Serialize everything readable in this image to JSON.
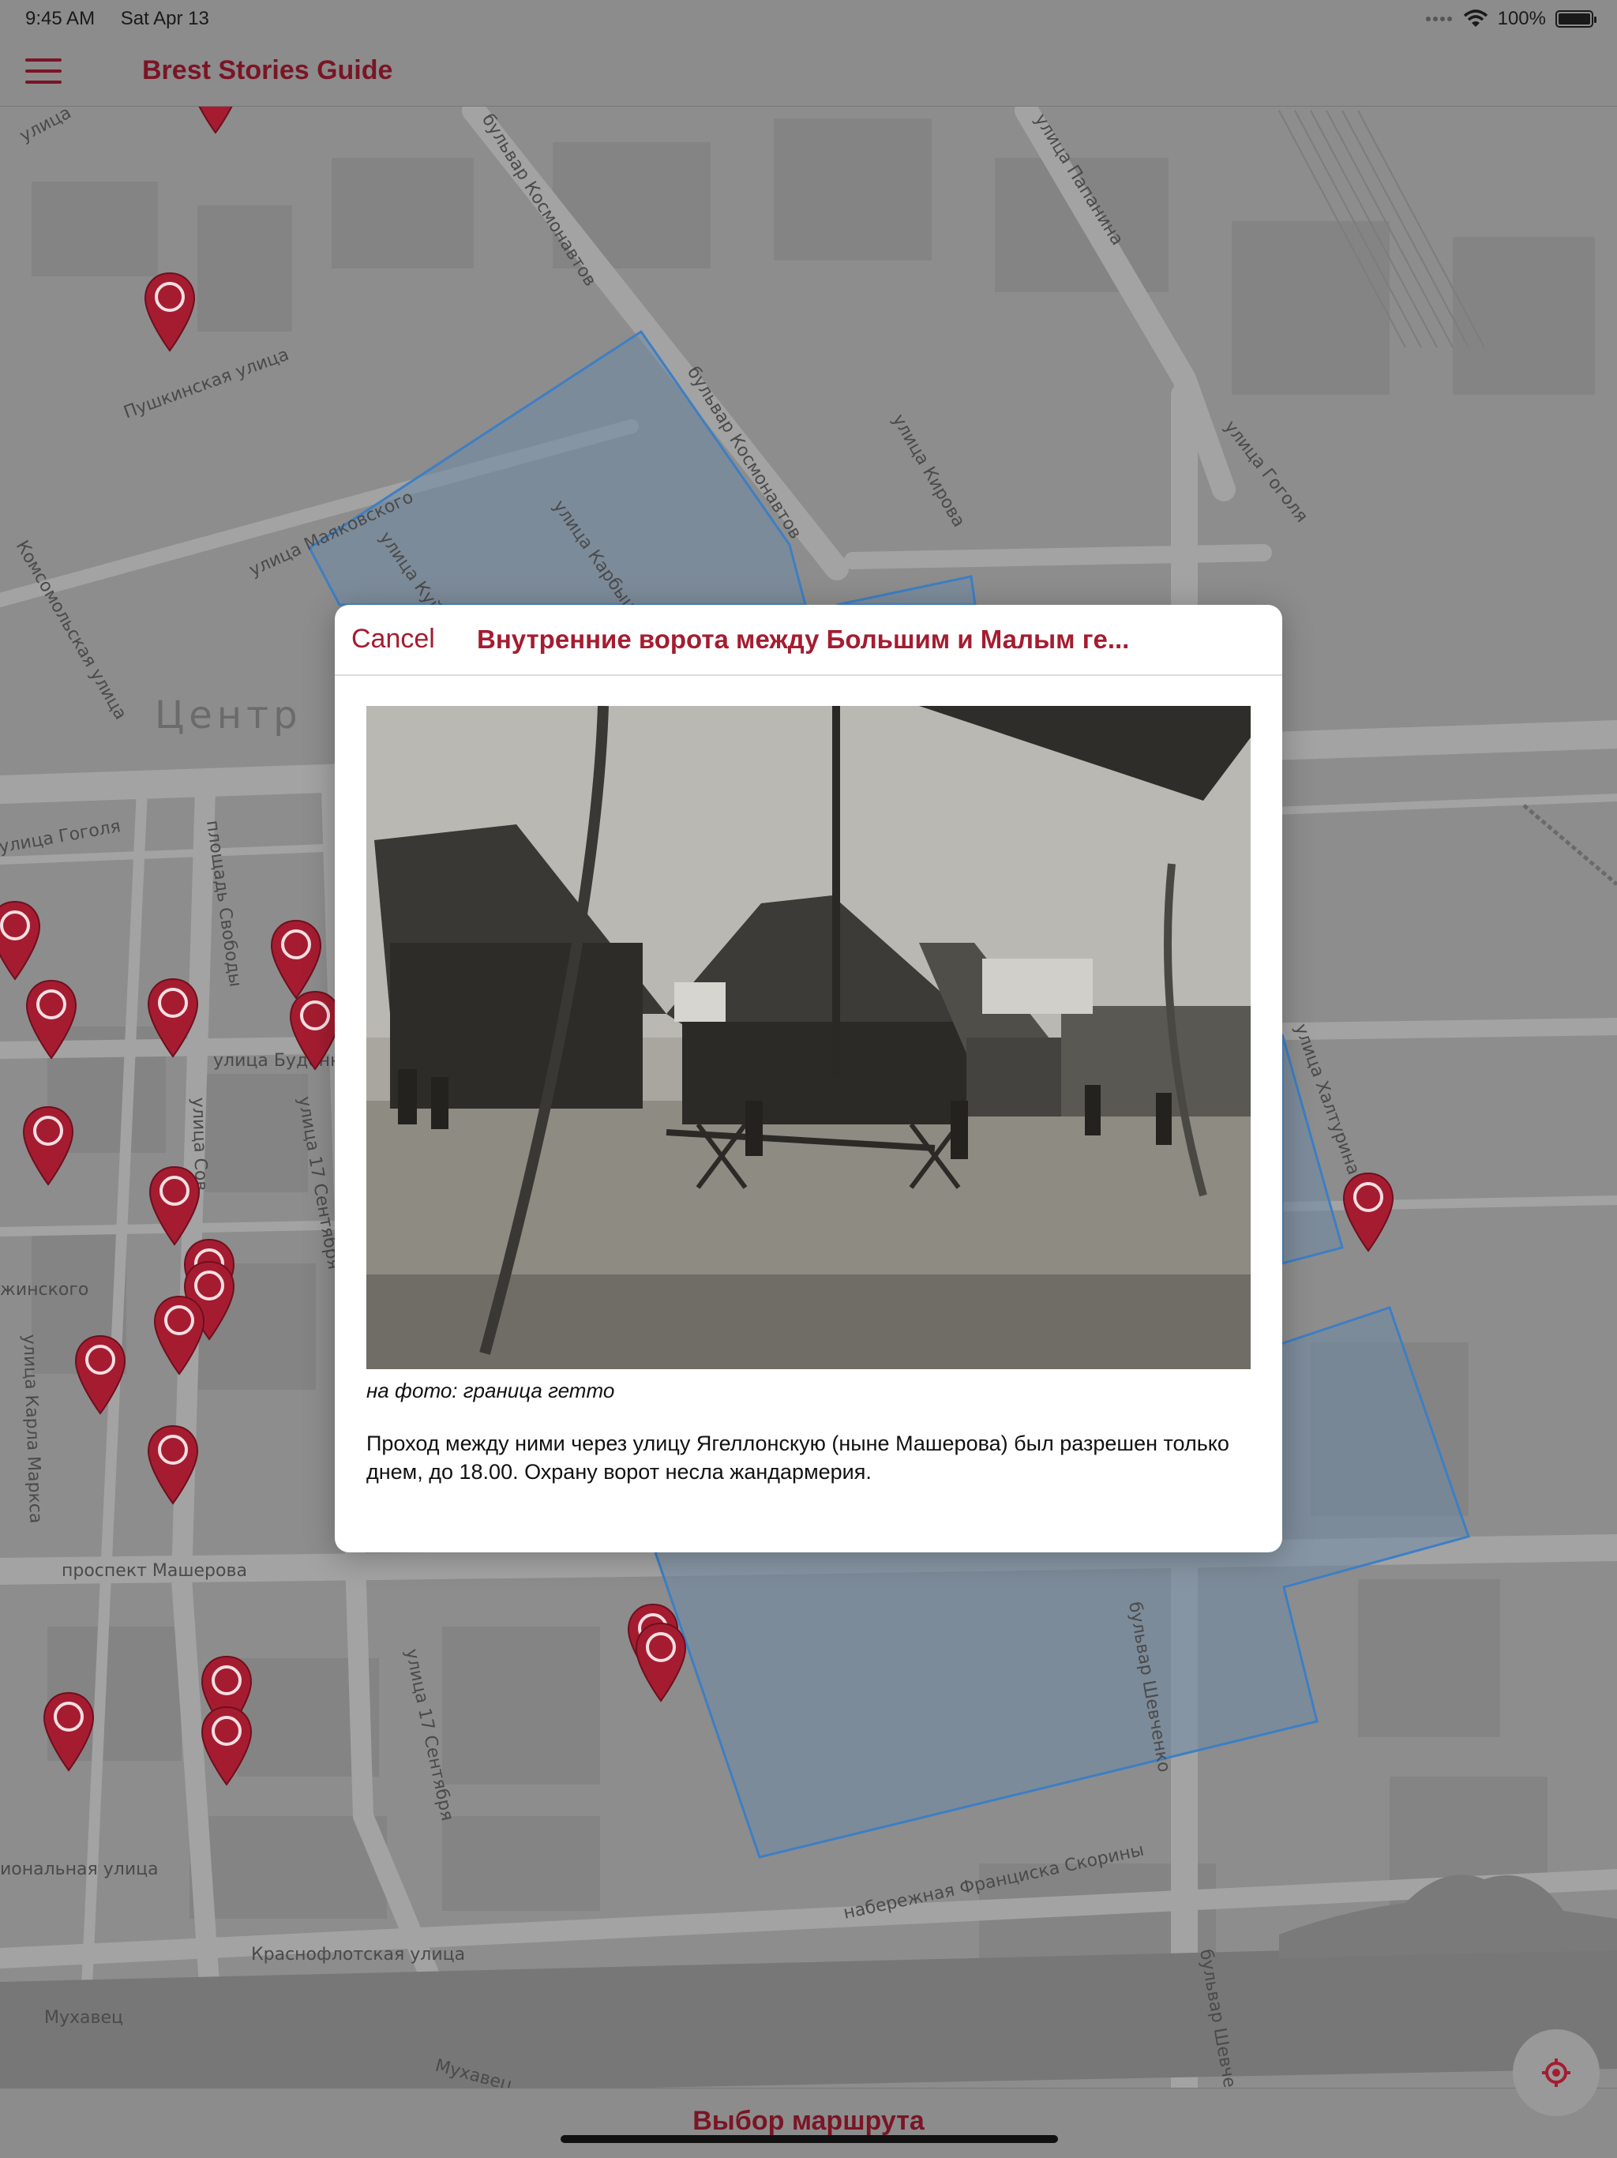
{
  "status_bar": {
    "time": "9:45 AM",
    "date": "Sat Apr 13",
    "battery": "100%",
    "battery_level": 1.0,
    "icons": [
      "signal-dots-icon",
      "wifi-icon",
      "battery-icon"
    ]
  },
  "nav": {
    "menu_icon": "hamburger-icon",
    "title": "Brest Stories Guide"
  },
  "map": {
    "district": "Центр",
    "streets": [
      "улица",
      "бульвар Космонавтов",
      "улица Папанина",
      "Пушкинская улица",
      "бульвар Космонавтов",
      "улица Кирова",
      "улица Гоголя",
      "улица Маяковского",
      "улица Куйб",
      "улица Карбыше",
      "Комсомольская улица",
      "улица Гоголя",
      "площадь Свободы",
      "улица Будённ",
      "улица Сов",
      "улица 17 Сентября",
      "жинского",
      "улица Карла Маркса",
      "проспект Машерова",
      "улица 17 Сентября",
      "бульвар Шевченко",
      "набережная Франциска Скорины",
      "иональная улица",
      "Краснофлотская улица",
      "Мухавец",
      "Мухавец",
      "бульвар Шевче",
      "улица Халтурина"
    ],
    "accent_color": "#a51c30",
    "ghetto_color": "#3d7fc4"
  },
  "modal": {
    "cancel_label": "Cancel",
    "title": "Внутренние ворота между Большим и Малым ге...",
    "photo_icon": "historic-photo-image",
    "caption": "на фото: граница гетто",
    "body": "Проход между ними через улицу Ягеллонскую (ныне Машерова) был разрешен только днем, до 18.00. Охрану ворот несла жандармерия."
  },
  "bottom_bar": {
    "route_label": "Выбор маршрута",
    "locate_icon": "locate-icon"
  }
}
